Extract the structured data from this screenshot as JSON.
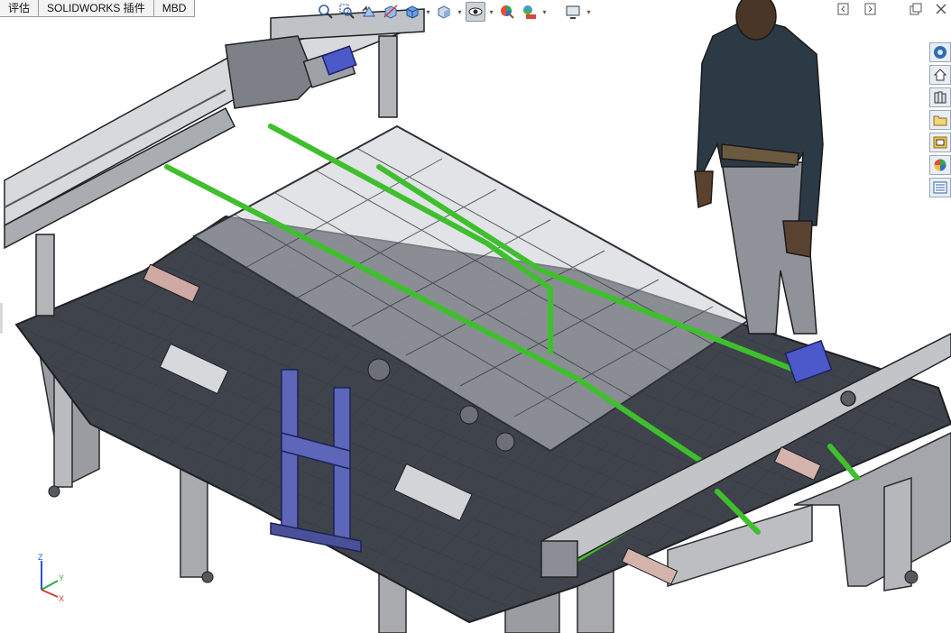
{
  "command_manager": {
    "tabs": [
      {
        "label": "评估"
      },
      {
        "label": "SOLIDWORKS 插件"
      },
      {
        "label": "MBD"
      }
    ]
  },
  "heads_up_toolbar": {
    "buttons": [
      {
        "icon": "zoom-to-fit-icon"
      },
      {
        "icon": "zoom-to-area-icon"
      },
      {
        "icon": "previous-view-icon"
      },
      {
        "icon": "section-view-icon"
      },
      {
        "icon": "view-orientation-icon",
        "has_menu": true
      },
      {
        "icon": "display-style-icon",
        "has_menu": true
      },
      {
        "icon": "hide-show-items-icon",
        "has_menu": true,
        "active": true
      },
      {
        "icon": "edit-appearance-icon"
      },
      {
        "icon": "apply-scene-icon",
        "has_menu": true
      },
      {
        "icon": "view-settings-icon",
        "has_menu": true
      }
    ]
  },
  "window_controls": [
    "restore-left-icon",
    "restore-right-icon",
    "tile-icon",
    "close-icon"
  ],
  "task_pane": [
    "solidworks-resources-icon",
    "home-icon",
    "design-library-icon",
    "file-explorer-icon",
    "view-palette-icon",
    "appearances-icon",
    "custom-properties-icon"
  ],
  "colors": {
    "frame_gray": "#8e9196",
    "plate_dark": "#3f434b",
    "belt_green": "#3fbf2e",
    "glass_panel": "#c8ccd2",
    "motor_blue": "#4b59c9",
    "stand_purple": "#5d66b8",
    "figure_shirt": "#2c3a46"
  },
  "triad": {
    "x": "X",
    "y": "Y",
    "z": "Z"
  }
}
